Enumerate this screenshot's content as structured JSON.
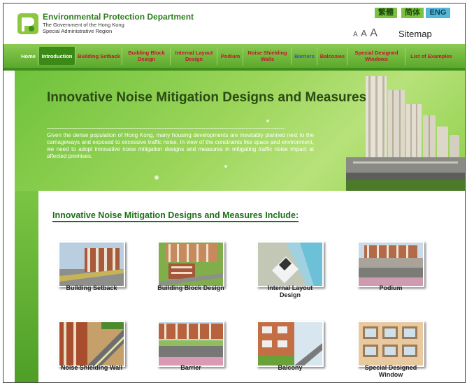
{
  "header": {
    "dept_name": "Environmental Protection Department",
    "dept_sub1": "The Government of the Hong Kong",
    "dept_sub2": "Special Administrative Region",
    "lang_tc": "繁體",
    "lang_sc": "简体",
    "lang_en": "ENG",
    "font_small": "A",
    "font_medium": "A",
    "font_large": "A",
    "sitemap": "Sitemap"
  },
  "nav": {
    "items": [
      {
        "label": "Home"
      },
      {
        "label": "Introduction"
      },
      {
        "label": "Building Setback"
      },
      {
        "label": "Building Block Design"
      },
      {
        "label": "Internal Layout Design"
      },
      {
        "label": "Podium"
      },
      {
        "label": "Noise Shielding Walls"
      },
      {
        "label": "Barriers"
      },
      {
        "label": "Balconies"
      },
      {
        "label": "Special Designed Windows"
      },
      {
        "label": "List of Examples"
      }
    ]
  },
  "banner": {
    "title": "Innovative Noise Mitigation Designs and Measures",
    "text": "Given the dense population of Hong Kong, many housing developments are inevitably planned next to the carriageways and exposed to excessive traffic noise. In view of the constraints like space and environment, we need to adopt innovative noise mitigation designs and measures in mitigating traffic noise impact at affected premises."
  },
  "content": {
    "heading": "Innovative Noise Mitigation Designs and Measures Include:",
    "items": [
      {
        "label": "Building Setback"
      },
      {
        "label": "Building Block Design"
      },
      {
        "label": "Internal Layout Design"
      },
      {
        "label": "Podium"
      },
      {
        "label": "Noise Shielding Wall"
      },
      {
        "label": "Barrier"
      },
      {
        "label": "Balcony"
      },
      {
        "label": "Special Designed Window"
      }
    ]
  },
  "colors": {
    "brand_green": "#2f7d21",
    "nav_text": "#c8102e",
    "lang_green": "#7cc142",
    "lang_blue": "#54b7d8"
  }
}
